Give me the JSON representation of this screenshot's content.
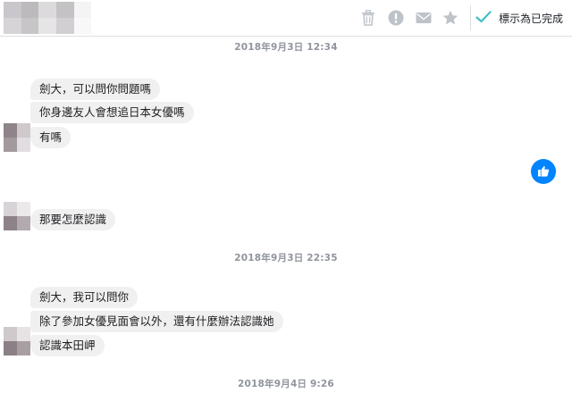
{
  "header": {
    "icons": [
      "trash-icon",
      "alert-icon",
      "envelope-icon",
      "star-icon",
      "checkmark-icon"
    ],
    "mark_done_label": "標示為已完成",
    "accent_color": "#44bec7",
    "icon_color": "#bec2c9"
  },
  "conversation": {
    "timestamps": [
      "2018年9月3日 12:34",
      "2018年9月3日 22:35",
      "2018年9月4日 9:26"
    ],
    "group1": [
      "劍大，可以問你問題嗎",
      "你身邊友人會想追日本女優嗎",
      "有嗎"
    ],
    "group2": [
      "那要怎麼認識"
    ],
    "group3": [
      "劍大，我可以問你",
      "除了參加女優見面會以外，還有什麼辦法認識她",
      "認識本田岬"
    ],
    "outgoing_sticker_icon": "like-icon",
    "outgoing_color": "#0084ff",
    "bubble_color": "#f1f0f0"
  }
}
